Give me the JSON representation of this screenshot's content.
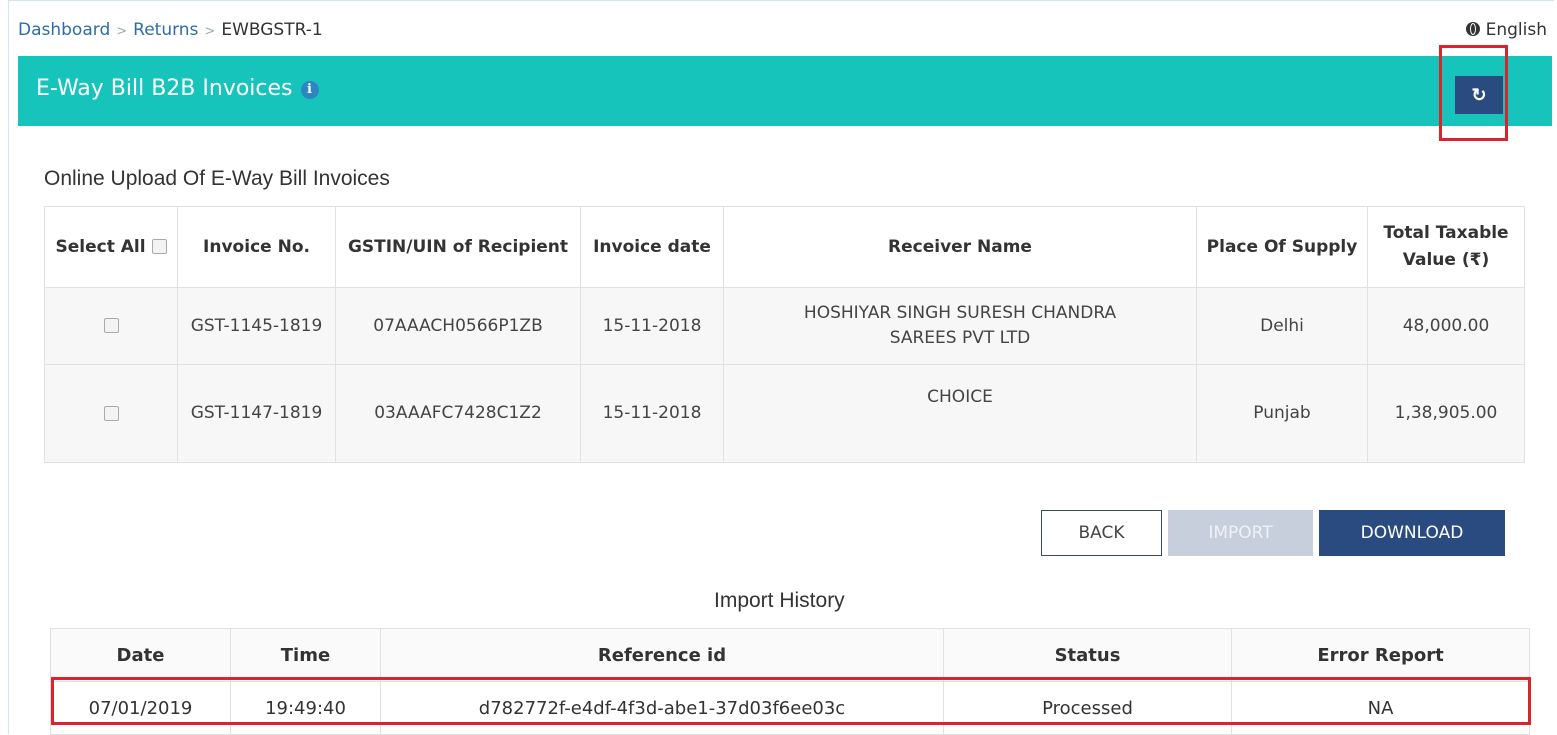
{
  "breadcrumb": {
    "items": [
      "Dashboard",
      "Returns"
    ],
    "current": "EWBGSTR-1"
  },
  "language": "English",
  "band": {
    "title": "E-Way Bill B2B Invoices",
    "info_icon": "info-icon",
    "refresh_icon": "↻"
  },
  "section_title": "Online Upload Of E-Way Bill Invoices",
  "invoice_table": {
    "select_all": "Select All",
    "headers": [
      "Invoice No.",
      "GSTIN/UIN of Recipient",
      "Invoice date",
      "Receiver Name",
      "Place Of Supply",
      "Total Taxable Value (₹)"
    ],
    "rows": [
      {
        "invoice_no": "GST-1145-1819",
        "gstin": "07AAACH0566P1ZB",
        "date": "15-11-2018",
        "receiver": "HOSHIYAR SINGH SURESH CHANDRA SAREES PVT LTD",
        "place": "Delhi",
        "value": "48,000.00"
      },
      {
        "invoice_no": "GST-1147-1819",
        "gstin": "03AAAFC7428C1Z2",
        "date": "15-11-2018",
        "receiver": "CHOICE",
        "place": "Punjab",
        "value": "1,38,905.00"
      }
    ]
  },
  "buttons": {
    "back": "BACK",
    "import": "IMPORT",
    "download": "DOWNLOAD"
  },
  "import_history": {
    "title": "Import History",
    "headers": [
      "Date",
      "Time",
      "Reference id",
      "Status",
      "Error Report"
    ],
    "rows": [
      {
        "date": "07/01/2019",
        "time": "19:49:40",
        "ref": "d782772f-e4df-4f3d-abe1-37d03f6ee03c",
        "status": "Processed",
        "error": "NA"
      }
    ]
  },
  "colors": {
    "band": "#17c4bb",
    "primary": "#2a4b80",
    "highlight": "#d9232d"
  }
}
